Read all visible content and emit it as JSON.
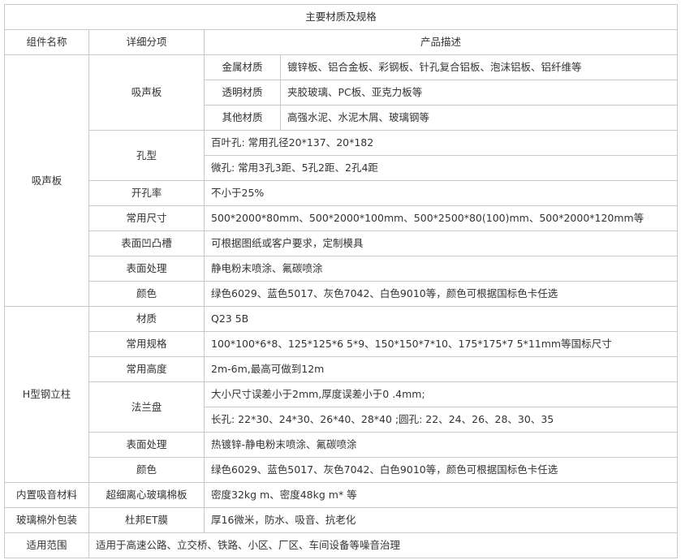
{
  "title": "主要材质及规格",
  "headers": {
    "component": "组件名称",
    "detail": "详细分项",
    "description": "产品描述"
  },
  "panel": {
    "name": "吸声板",
    "absorb": {
      "label": "吸声板",
      "metal": {
        "label": "金属材质",
        "value": "镀锌板、铝合金板、彩钢板、针孔复合铝板、泡沫铝板、铝纤维等"
      },
      "transparent": {
        "label": "透明材质",
        "value": "夹胶玻璃、PC板、亚克力板等"
      },
      "other": {
        "label": "其他材质",
        "value": "高强水泥、水泥木屑、玻璃钢等"
      }
    },
    "hole": {
      "label": "孔型",
      "value1": "百叶孔: 常用孔径20*137、20*182",
      "value2": "微孔: 常用3孔3距、5孔2距、2孔4距"
    },
    "open_rate": {
      "label": "开孔率",
      "value": "不小于25%"
    },
    "size": {
      "label": "常用尺寸",
      "value": "500*2000*80mm、500*2000*100mm、500*2500*80(100)mm、500*2000*120mm等"
    },
    "groove": {
      "label": "表面凹凸槽",
      "value": "可根据图纸或客户要求，定制模具"
    },
    "surface": {
      "label": "表面处理",
      "value": "静电粉末喷涂、氟碳喷涂"
    },
    "color": {
      "label": "颜色",
      "value": "绿色6029、蓝色5017、灰色7042、白色9010等，颜色可根据国标色卡任选"
    }
  },
  "column": {
    "name": "H型钢立柱",
    "material": {
      "label": "材质",
      "value": "Q23 5B"
    },
    "spec": {
      "label": "常用规格",
      "value": "100*100*6*8、125*125*6 5*9、150*150*7*10、175*175*7 5*11mm等国标尺寸"
    },
    "height": {
      "label": "常用高度",
      "value": "2m-6m,最高可做到12m"
    },
    "flange": {
      "label": "法兰盘",
      "value1": "大小尺寸误差小于2mm,厚度误差小于0 .4mm;",
      "value2": "长孔: 22*30、24*30、26*40、28*40 ;圆孔: 22、24、26、28、30、35"
    },
    "surface": {
      "label": "表面处理",
      "value": "热镀锌-静电粉末喷涂、氟碳喷涂"
    },
    "color": {
      "label": "颜色",
      "value": "绿色6029、蓝色5017、灰色7042、白色9010等，颜色可根据国标色卡任选"
    }
  },
  "inner": {
    "name": "内置吸音材料",
    "label": "超细离心玻璃棉板",
    "value": "密度32kg m、密度48kg m* 等"
  },
  "wrap": {
    "name": "玻璃棉外包装",
    "label": "杜邦ET膜",
    "value": "厚16微米，防水、吸音、抗老化"
  },
  "scope": {
    "name": "适用范围",
    "value": "适用于高速公路、立交桥、铁路、小区、厂区、车间设备等噪音治理"
  }
}
